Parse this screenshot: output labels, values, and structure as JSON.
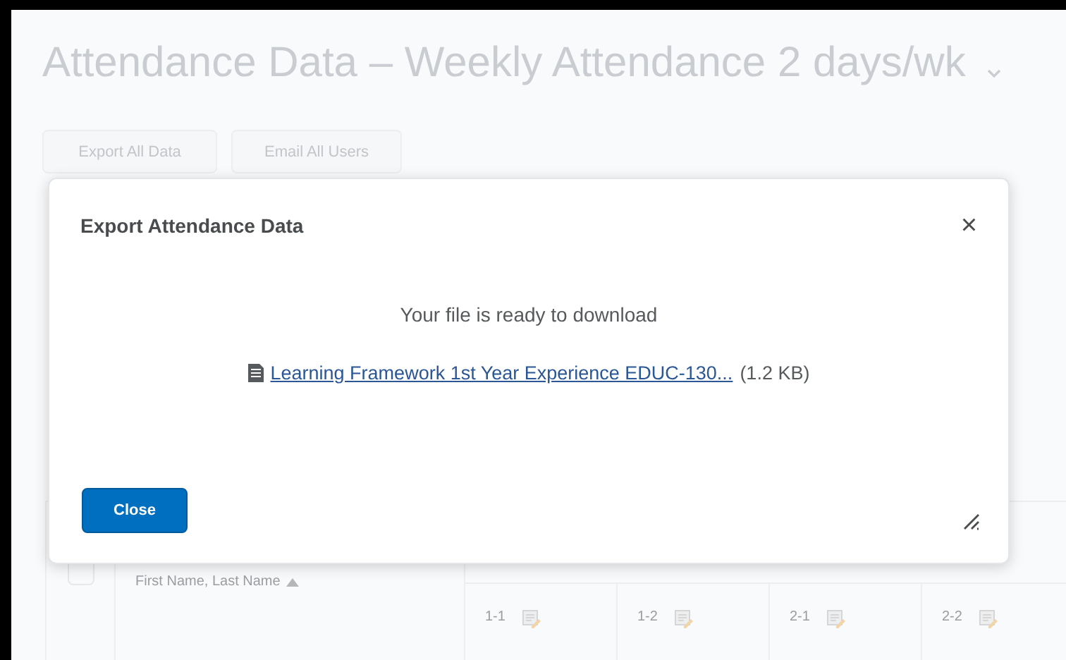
{
  "page": {
    "title": "Attendance Data – Weekly Attendance 2 days/wk",
    "buttons": [
      "Export All Data",
      "Email All Users"
    ]
  },
  "table": {
    "name_header": "First Name, Last Name",
    "select_all": {
      "checked": false
    },
    "columns": [
      {
        "label": "1-1"
      },
      {
        "label": "1-2"
      },
      {
        "label": "2-1"
      },
      {
        "label": "2-2"
      }
    ]
  },
  "dialog": {
    "title": "Export Attendance Data",
    "close_symbol": "×",
    "message": "Your file is ready to download",
    "file_link": "Learning Framework 1st Year Experience EDUC-130...",
    "file_size": "(1.2 KB)",
    "button": "Close"
  }
}
